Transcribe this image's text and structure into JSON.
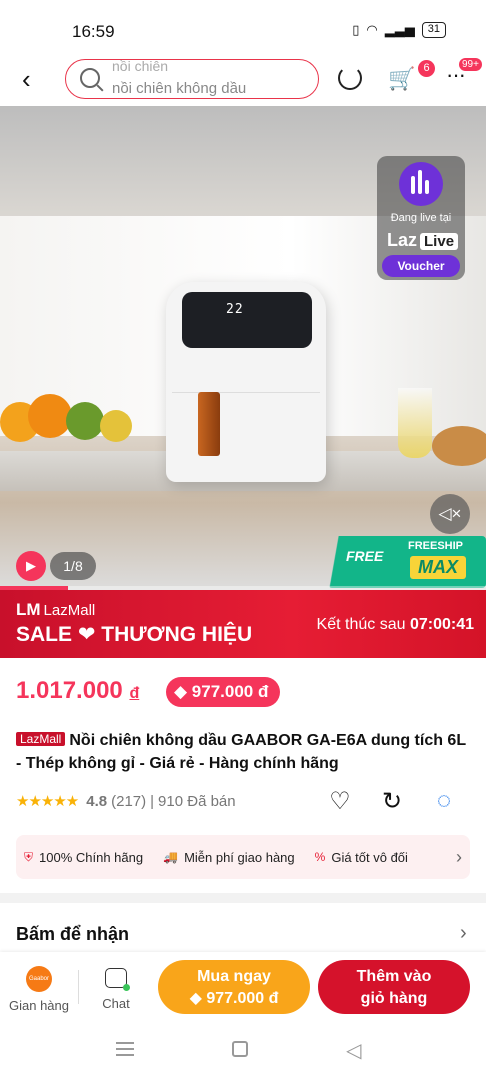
{
  "status": {
    "time": "16:59",
    "battery": "31"
  },
  "header": {
    "search_suggestion_top": "nồi chiên",
    "search_suggestion": "nồi chiên không dầu",
    "cart_badge": "6",
    "more_badge": "99+"
  },
  "hero": {
    "fryer_display": "22",
    "live_text": "Đang live tại",
    "live_brand": "Laz",
    "live_brand_tag": "Live",
    "live_voucher": "Voucher",
    "pager": "1/8",
    "freeship_free": "FREE",
    "freeship_label": "FREESHIP",
    "freeship_max": "MAX",
    "video_progress": 0.14
  },
  "sale": {
    "lazmall": "LazMall",
    "title": "SALE ❤ THƯƠNG HIỆU",
    "ends_label": "Kết thúc sau",
    "ends_time": "07:00:41"
  },
  "price": {
    "current": "1.017.000",
    "currency": "đ",
    "voucher_price": "977.000 đ"
  },
  "product": {
    "badge": "LazMall",
    "title": "Nồi chiên không dầu GAABOR GA-E6A dung tích 6L - Thép không gỉ - Giá rẻ - Hàng chính hãng",
    "stars": "★★★★★",
    "score": "4.8",
    "reviews": "(217)",
    "sold": "910 Đã bán"
  },
  "badges": [
    {
      "icon": "shield-icon",
      "label": "100% Chính hãng"
    },
    {
      "icon": "truck-icon",
      "label": "Miễn phí giao hàng"
    },
    {
      "icon": "tag-icon",
      "label": "Giá tốt vô đối"
    }
  ],
  "section": {
    "tap_to_receive": "Bấm để nhận"
  },
  "actions": {
    "store_label": "Gian hàng",
    "store_logo": "Gaabor",
    "chat_label": "Chat",
    "buy_now": "Mua ngay",
    "buy_price": "977.000 đ",
    "add_to_cart_line1": "Thêm vào",
    "add_to_cart_line2": "giỏ hàng"
  }
}
